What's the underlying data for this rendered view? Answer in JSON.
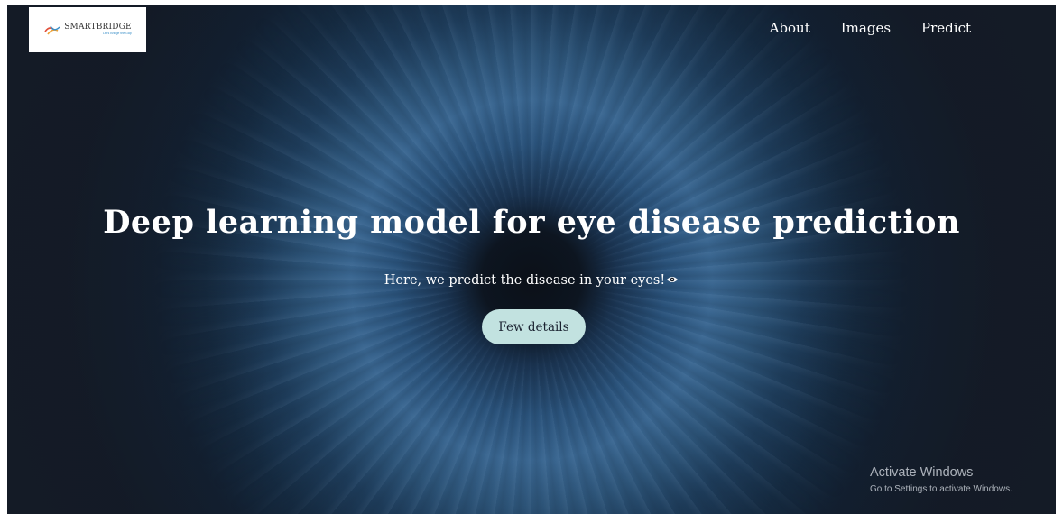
{
  "brand": {
    "name": "SMARTBRIDGE",
    "tagline": "Let's Bridge the Gap"
  },
  "nav": {
    "items": [
      {
        "label": "About"
      },
      {
        "label": "Images"
      },
      {
        "label": "Predict"
      }
    ]
  },
  "hero": {
    "title": "Deep learning model for eye disease prediction",
    "subtitle": "Here, we predict the disease in your eyes!",
    "subtitle_icon": "eye-icon",
    "button_label": "Few details"
  },
  "watermark": {
    "title": "Activate Windows",
    "subtitle": "Go to Settings to activate Windows."
  },
  "colors": {
    "background": "#141b26",
    "iris": "#2a527a",
    "button": "#c2e2e0",
    "text": "#ffffff"
  }
}
